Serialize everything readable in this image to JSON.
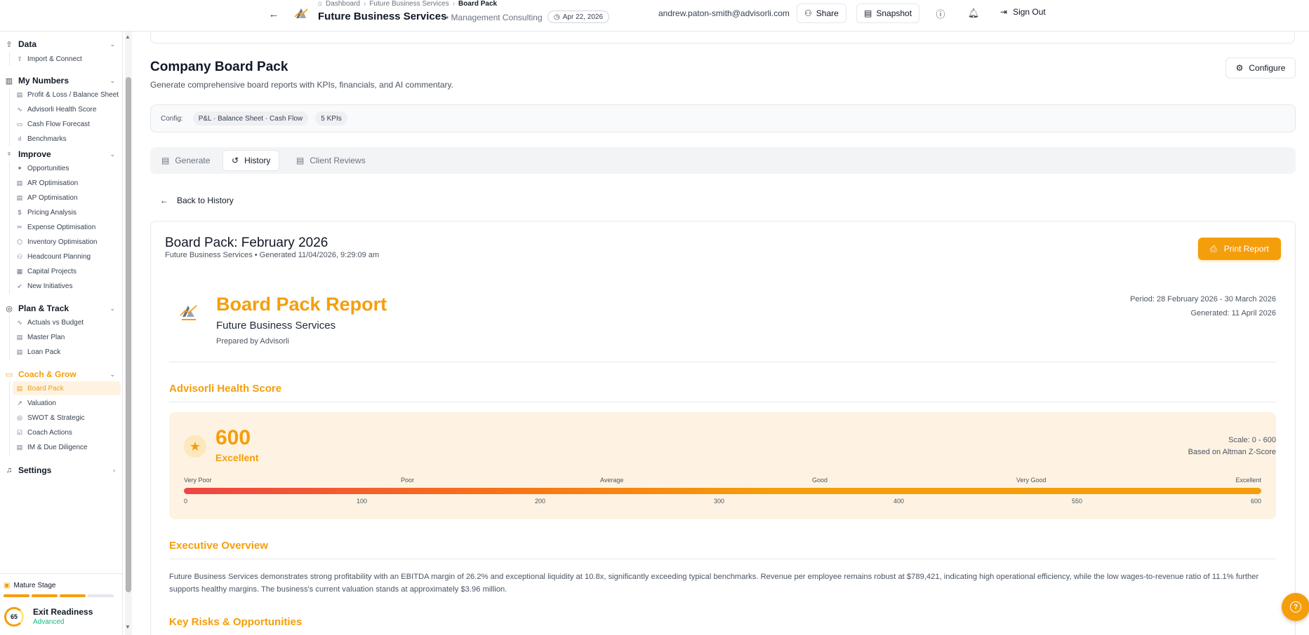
{
  "header": {
    "breadcrumbs": [
      "Dashboard",
      "Future Business Services",
      "Board Pack"
    ],
    "company": "Future Business Services",
    "industry": "• Management Consulting",
    "date": "Apr 22, 2026",
    "email": "andrew.paton-smith@advisorli.com",
    "share_label": "Share",
    "snapshot_label": "Snapshot",
    "signout_label": "Sign Out"
  },
  "sidebar": {
    "sections": [
      {
        "label": "Data",
        "icon": "upload-icon",
        "items": [
          {
            "label": "Import & Connect",
            "icon": "upload-icon"
          }
        ]
      },
      {
        "label": "My Numbers",
        "icon": "bar-chart-icon",
        "items": [
          {
            "label": "Profit & Loss / Balance Sheet",
            "icon": "document-icon"
          },
          {
            "label": "Advisorli Health Score",
            "icon": "activity-icon"
          },
          {
            "label": "Cash Flow Forecast",
            "icon": "wallet-icon"
          },
          {
            "label": "Benchmarks",
            "icon": "bar-chart-icon"
          }
        ]
      },
      {
        "label": "Improve",
        "icon": "lightbulb-icon",
        "items": [
          {
            "label": "Opportunities",
            "icon": "sparkle-icon"
          },
          {
            "label": "AR Optimisation",
            "icon": "receipt-icon"
          },
          {
            "label": "AP Optimisation",
            "icon": "receipt-icon"
          },
          {
            "label": "Pricing Analysis",
            "icon": "dollar-icon"
          },
          {
            "label": "Expense Optimisation",
            "icon": "scissors-icon"
          },
          {
            "label": "Inventory Optimisation",
            "icon": "box-icon"
          },
          {
            "label": "Headcount Planning",
            "icon": "users-icon"
          },
          {
            "label": "Capital Projects",
            "icon": "building-icon"
          },
          {
            "label": "New Initiatives",
            "icon": "rocket-icon"
          }
        ]
      },
      {
        "label": "Plan & Track",
        "icon": "target-icon",
        "items": [
          {
            "label": "Actuals vs Budget",
            "icon": "activity-icon"
          },
          {
            "label": "Master Plan",
            "icon": "clipboard-icon"
          },
          {
            "label": "Loan Pack",
            "icon": "clipboard-icon"
          }
        ]
      },
      {
        "label": "Coach & Grow",
        "icon": "chat-icon",
        "items": [
          {
            "label": "Board Pack",
            "icon": "document-icon"
          },
          {
            "label": "Valuation",
            "icon": "trend-icon"
          },
          {
            "label": "SWOT & Strategic",
            "icon": "target-icon"
          },
          {
            "label": "Coach Actions",
            "icon": "check-square-icon"
          },
          {
            "label": "IM & Due Diligence",
            "icon": "clipboard-icon"
          }
        ]
      },
      {
        "label": "Settings",
        "icon": "bell-icon",
        "items": []
      }
    ],
    "stage": "Mature Stage",
    "stage_progress": 0.75,
    "exit_score": "65",
    "exit_label": "Exit Readiness",
    "exit_level": "Advanced"
  },
  "page": {
    "title": "Company Board Pack",
    "subtitle": "Generate comprehensive board reports with KPIs, financials, and AI commentary.",
    "configure_label": "Configure",
    "config_label": "Config:",
    "config_chips": [
      "P&L · Balance Sheet · Cash Flow",
      "5 KPIs"
    ],
    "tabs": [
      {
        "label": "Generate",
        "icon": "document-icon"
      },
      {
        "label": "History",
        "icon": "history-icon"
      },
      {
        "label": "Client Reviews",
        "icon": "clipboard-icon"
      }
    ],
    "active_tab": "History",
    "back_label": "Back to History"
  },
  "report": {
    "title": "Board Pack: February 2026",
    "meta": "Future Business Services • Generated 11/04/2026, 9:29:09 am",
    "print_label": "Print Report",
    "doc_title": "Board Pack Report",
    "doc_company": "Future Business Services",
    "doc_prepared": "Prepared by Advisorli",
    "period": "Period: 28 February 2026 - 30 March 2026",
    "generated": "Generated: 11 April 2026",
    "health_heading": "Advisorli Health Score",
    "score": "600",
    "grade": "Excellent",
    "scale": "Scale: 0 - 600",
    "basis": "Based on Altman Z-Score",
    "grade_labels": [
      "Very Poor",
      "Poor",
      "Average",
      "Good",
      "Very Good",
      "Excellent"
    ],
    "tick_labels": [
      "0",
      "100",
      "200",
      "300",
      "400",
      "550",
      "600"
    ],
    "score_fraction": 1.0,
    "exec_heading": "Executive Overview",
    "exec_text": "Future Business Services demonstrates strong profitability with an EBITDA margin of 26.2% and exceptional liquidity at 10.8x, significantly exceeding typical benchmarks. Revenue per employee remains robust at $789,421, indicating high operational efficiency, while the low wages-to-revenue ratio of 11.1% further supports healthy margins. The business's current valuation stands at approximately $3.96 million.",
    "risks_heading": "Key Risks & Opportunities"
  },
  "colors": {
    "accent": "#f59e0b",
    "accent_soft": "#fef3e2",
    "success": "#10b981"
  }
}
